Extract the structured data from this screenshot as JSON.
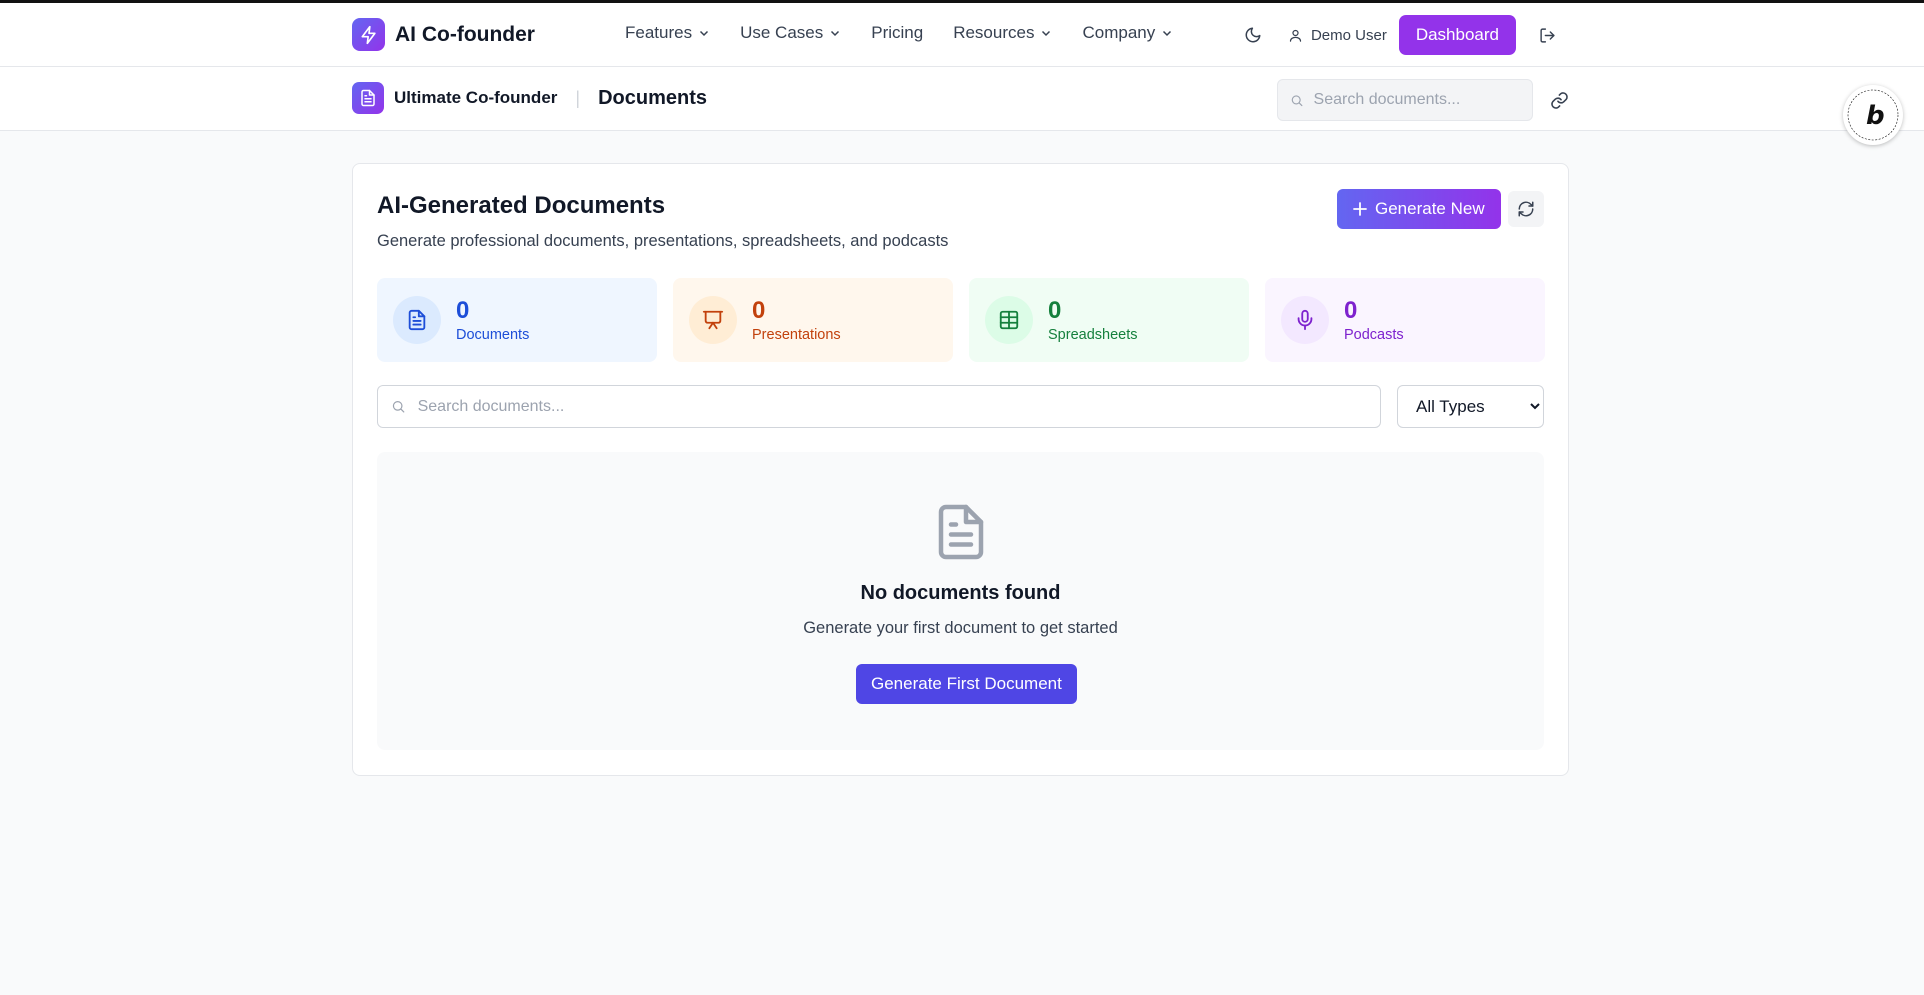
{
  "brand": {
    "name": "AI Co-founder"
  },
  "nav": {
    "links": [
      {
        "label": "Features",
        "dropdown": true
      },
      {
        "label": "Use Cases",
        "dropdown": true
      },
      {
        "label": "Pricing",
        "dropdown": false
      },
      {
        "label": "Resources",
        "dropdown": true
      },
      {
        "label": "Company",
        "dropdown": true
      }
    ],
    "user_name": "Demo User",
    "dashboard_label": "Dashboard"
  },
  "subheader": {
    "app_name": "Ultimate Co-founder",
    "page_title": "Documents",
    "search_placeholder": "Search documents..."
  },
  "main": {
    "title": "AI-Generated Documents",
    "subtitle": "Generate professional documents, presentations, spreadsheets, and podcasts",
    "generate_label": "Generate New",
    "stats": [
      {
        "value": "0",
        "label": "Documents",
        "icon": "file-text-icon",
        "bg": "#eff6ff",
        "icon_bg": "#dbeafe",
        "color": "#1d4ed8"
      },
      {
        "value": "0",
        "label": "Presentations",
        "icon": "presentation-icon",
        "bg": "#fff7ed",
        "icon_bg": "#ffedd5",
        "color": "#c2410c"
      },
      {
        "value": "0",
        "label": "Spreadsheets",
        "icon": "table-icon",
        "bg": "#f0fdf4",
        "icon_bg": "#dcfce7",
        "color": "#15803d"
      },
      {
        "value": "0",
        "label": "Podcasts",
        "icon": "mic-icon",
        "bg": "#faf5ff",
        "icon_bg": "#f3e8ff",
        "color": "#7e22ce"
      }
    ],
    "search_placeholder": "Search documents...",
    "type_filter": {
      "selected": "All Types"
    },
    "empty_state": {
      "title": "No documents found",
      "subtitle": "Generate your first document to get started",
      "button_label": "Generate First Document"
    }
  }
}
